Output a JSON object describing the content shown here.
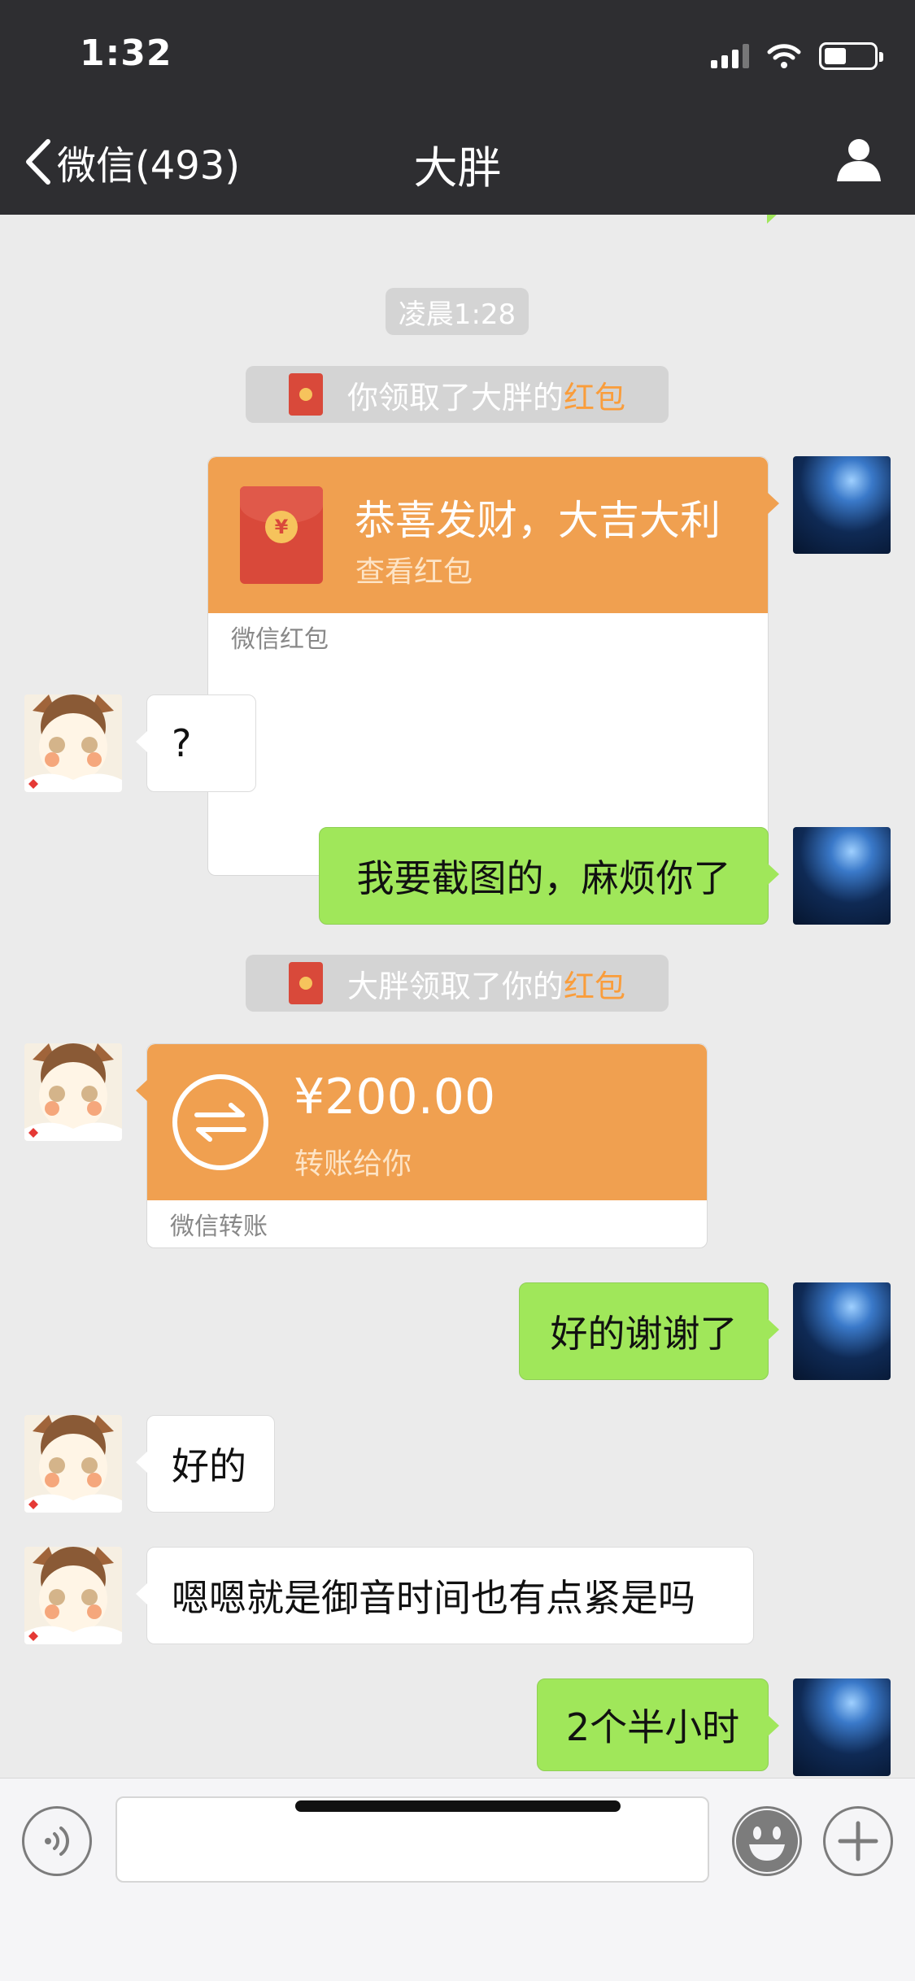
{
  "status_bar": {
    "time": "1:32"
  },
  "nav": {
    "back_label": "微信(493)",
    "title": "大胖"
  },
  "messages": {
    "timestamp": "凌晨1:28",
    "sys1": {
      "before": "你领取了大胖的",
      "accent": "红包"
    },
    "red_packet": {
      "greeting": "恭喜发财，大吉大利",
      "action": "查看红包",
      "footer": "微信红包",
      "symbol": "¥"
    },
    "m1": "?",
    "m2": "我要截图的，麻烦你了",
    "sys2": {
      "before": "大胖领取了你的",
      "accent": "红包"
    },
    "transfer": {
      "amount": "¥200.00",
      "desc": "转账给你",
      "footer": "微信转账"
    },
    "m3": "好的谢谢了",
    "m4": "好的",
    "m5": "嗯嗯就是御音时间也有点紧是吗",
    "m6": "2个半小时"
  },
  "colors": {
    "header_bg": "#2e2e31",
    "chat_bg": "#ebebeb",
    "outgoing_bubble": "#a0e75a",
    "money_card": "#f0a050",
    "accent": "#fa9d3b"
  },
  "icons": [
    "back-chevron-icon",
    "signal-icon",
    "wifi-icon",
    "battery-icon",
    "profile-icon",
    "voice-icon",
    "emoji-icon",
    "plus-icon",
    "red-envelope-icon",
    "transfer-icon"
  ]
}
